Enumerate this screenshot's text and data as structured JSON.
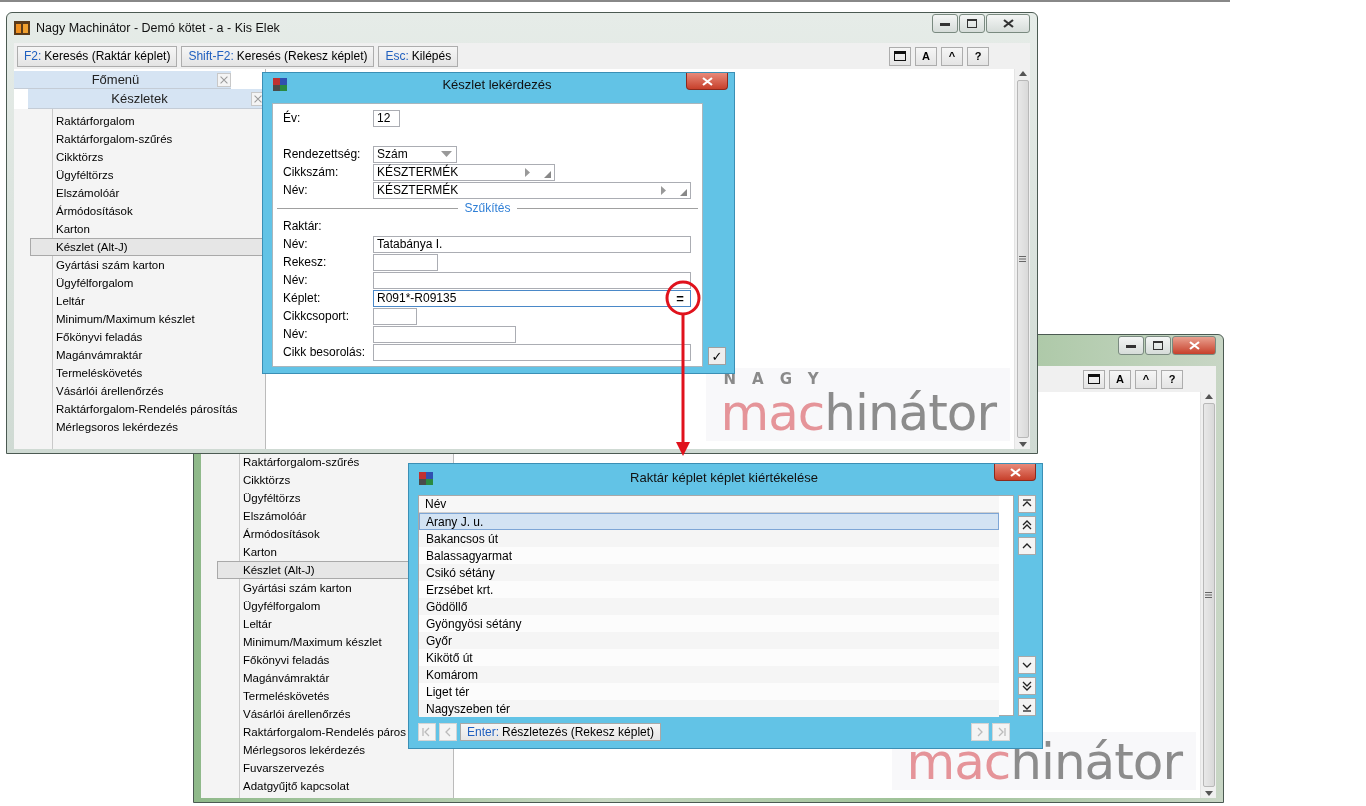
{
  "main_window": {
    "title": "Nagy Machinátor - Demó kötet - a - Kis Elek",
    "controls_highlighted": false,
    "toolbar": [
      {
        "key": "F2:",
        "label": "Keresés (Raktár képlet)"
      },
      {
        "key": "Shift-F2:",
        "label": "Keresés (Rekesz képlet)"
      },
      {
        "key": "Esc:",
        "label": "Kilépés"
      }
    ],
    "view_buttons": [
      {
        "kind": "window"
      },
      {
        "kind": "text",
        "label": "A"
      },
      {
        "kind": "text",
        "label": "^"
      },
      {
        "kind": "text",
        "label": "?"
      }
    ],
    "menu_title": "Főmenü",
    "submenu_title": "Készletek",
    "menu_items": [
      {
        "label": "Raktárforgalom",
        "selected": false
      },
      {
        "label": "Raktárforgalom-szűrés",
        "selected": false
      },
      {
        "label": "Cikktörzs",
        "selected": false
      },
      {
        "label": "Ügyféltörzs",
        "selected": false
      },
      {
        "label": "Elszámolóár",
        "selected": false
      },
      {
        "label": "Ármódosítások",
        "selected": false
      },
      {
        "label": "Karton",
        "selected": false
      },
      {
        "label": "Készlet (Alt-J)",
        "selected": true
      },
      {
        "label": "Gyártási szám karton",
        "selected": false
      },
      {
        "label": "Ügyfélforgalom",
        "selected": false
      },
      {
        "label": "Leltár",
        "selected": false
      },
      {
        "label": "Minimum/Maximum készlet",
        "selected": false
      },
      {
        "label": "Főkönyvi feladás",
        "selected": false
      },
      {
        "label": "Magánvámraktár",
        "selected": false
      },
      {
        "label": "Termeléskövetés",
        "selected": false
      },
      {
        "label": "Vásárlói árellenőrzés",
        "selected": false
      },
      {
        "label": "Raktárforgalom-Rendelés párosítás",
        "selected": false
      },
      {
        "label": "Mérlegsoros lekérdezés",
        "selected": false
      }
    ],
    "logo": {
      "tagline": "NAGY",
      "accent": "mac",
      "rest": "hinátor"
    }
  },
  "back_window": {
    "controls_highlighted": true,
    "view_buttons": [
      {
        "kind": "window"
      },
      {
        "kind": "text",
        "label": "A"
      },
      {
        "kind": "text",
        "label": "^"
      },
      {
        "kind": "text",
        "label": "?"
      }
    ],
    "menu_items": [
      {
        "label": "Raktárforgalom-szűrés",
        "selected": false
      },
      {
        "label": "Cikktörzs",
        "selected": false
      },
      {
        "label": "Ügyféltörzs",
        "selected": false
      },
      {
        "label": "Elszámolóár",
        "selected": false
      },
      {
        "label": "Ármódosítások",
        "selected": false
      },
      {
        "label": "Karton",
        "selected": false
      },
      {
        "label": "Készlet (Alt-J)",
        "selected": true
      },
      {
        "label": "Gyártási szám karton",
        "selected": false
      },
      {
        "label": "Ügyfélforgalom",
        "selected": false
      },
      {
        "label": "Leltár",
        "selected": false
      },
      {
        "label": "Minimum/Maximum készlet",
        "selected": false
      },
      {
        "label": "Főkönyvi feladás",
        "selected": false
      },
      {
        "label": "Magánvámraktár",
        "selected": false
      },
      {
        "label": "Termeléskövetés",
        "selected": false
      },
      {
        "label": "Vásárlói árellenőrzés",
        "selected": false
      },
      {
        "label": "Raktárforgalom-Rendelés páros",
        "selected": false
      },
      {
        "label": "Mérlegsoros lekérdezés",
        "selected": false
      },
      {
        "label": "Fuvarszervezés",
        "selected": false
      },
      {
        "label": "Adatgyűjtő kapcsolat",
        "selected": false
      }
    ],
    "logo": {
      "accent": "mac",
      "rest": "hinátor"
    }
  },
  "query_dialog": {
    "title": "Készlet lekérdezés",
    "confirm": "✓",
    "fields": [
      {
        "kind": "field",
        "label": "Év:",
        "value": "12"
      },
      {
        "kind": "combo",
        "label": "Rendezettség:",
        "value": "Szám"
      },
      {
        "kind": "lookup",
        "label": "Cikkszám:",
        "value": "KÉSZTERMÉK"
      },
      {
        "kind": "lookup",
        "label": "Név:",
        "value": "KÉSZTERMÉK"
      },
      {
        "kind": "divider",
        "label": "Szűkítés"
      },
      {
        "kind": "heading",
        "label": "Raktár:"
      },
      {
        "kind": "field",
        "label": "Név:",
        "value": "Tatabánya I."
      },
      {
        "kind": "field",
        "label": "Rekesz:"
      },
      {
        "kind": "field",
        "label": "Név:"
      },
      {
        "kind": "formula",
        "label": "Képlet:",
        "value": "R091*-R09135",
        "action": "="
      },
      {
        "kind": "field",
        "label": "Cikkcsoport:"
      },
      {
        "kind": "field",
        "label": "Név:"
      },
      {
        "kind": "field",
        "label": "Cikk besorolás:"
      }
    ]
  },
  "result_dialog": {
    "title": "Raktár képlet képlet kiértékelése",
    "column": "Név",
    "rows": [
      {
        "label": "Arany J. u.",
        "selected": true
      },
      {
        "label": "Bakancsos út",
        "selected": false
      },
      {
        "label": "Balassagyarmat",
        "selected": false
      },
      {
        "label": "Csikó sétány",
        "selected": false
      },
      {
        "label": "Erzsébet krt.",
        "selected": false
      },
      {
        "label": "Gödöllő",
        "selected": false
      },
      {
        "label": "Gyöngyösi sétány",
        "selected": false
      },
      {
        "label": "Győr",
        "selected": false
      },
      {
        "label": "Kikötő út",
        "selected": false
      },
      {
        "label": "Komárom",
        "selected": false
      },
      {
        "label": "Liget tér",
        "selected": false
      },
      {
        "label": "Nagyszeben tér",
        "selected": false
      }
    ],
    "scroll_up": [
      {
        "kind": "first"
      },
      {
        "kind": "page"
      },
      {
        "kind": "step"
      }
    ],
    "scroll_down": [
      {
        "kind": "step"
      },
      {
        "kind": "page"
      },
      {
        "kind": "first"
      }
    ],
    "pager_left": [
      {
        "kind": "first",
        "disabled": true
      },
      {
        "kind": "step",
        "disabled": true
      }
    ],
    "action": {
      "key": "Enter:",
      "label": "Részletezés (Rekesz képlet)"
    },
    "pager_right": [
      {
        "kind": "step",
        "disabled": true
      },
      {
        "kind": "first",
        "disabled": true
      }
    ]
  },
  "annotations": [
    {
      "kind": "circle"
    },
    {
      "kind": "arrow"
    }
  ]
}
